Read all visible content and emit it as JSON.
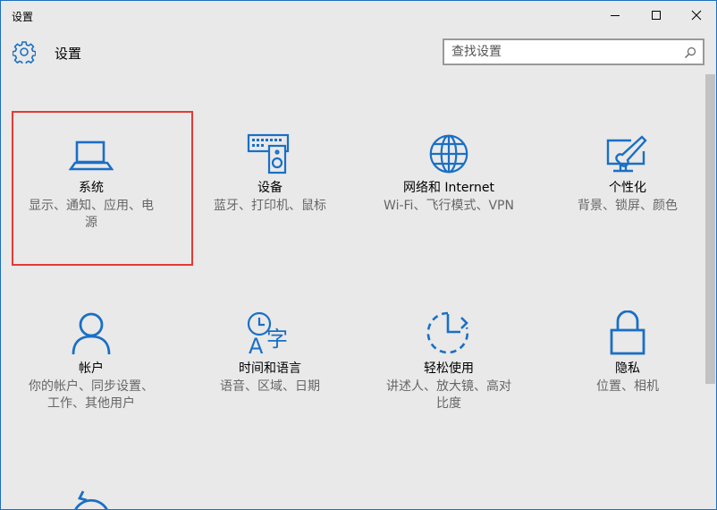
{
  "window": {
    "title": "设置"
  },
  "header": {
    "title": "设置"
  },
  "search": {
    "placeholder": "查找设置"
  },
  "colors": {
    "accent": "#1a6fc5",
    "highlight": "#e53935"
  },
  "tiles": [
    {
      "icon": "laptop-icon",
      "name": "系统",
      "desc1": "显示、通知、应用、电",
      "desc2": "源"
    },
    {
      "icon": "devices-icon",
      "name": "设备",
      "desc1": "蓝牙、打印机、鼠标",
      "desc2": ""
    },
    {
      "icon": "globe-icon",
      "name": "网络和 Internet",
      "desc1": "Wi-Fi、飞行模式、VPN",
      "desc2": ""
    },
    {
      "icon": "personalization-icon",
      "name": "个性化",
      "desc1": "背景、锁屏、颜色",
      "desc2": ""
    },
    {
      "icon": "person-icon",
      "name": "帐户",
      "desc1": "你的帐户、同步设置、",
      "desc2": "工作、其他用户"
    },
    {
      "icon": "time-language-icon",
      "name": "时间和语言",
      "desc1": "语音、区域、日期",
      "desc2": ""
    },
    {
      "icon": "ease-of-access-icon",
      "name": "轻松使用",
      "desc1": "讲述人、放大镜、高对",
      "desc2": "比度"
    },
    {
      "icon": "lock-icon",
      "name": "隐私",
      "desc1": "位置、相机",
      "desc2": ""
    }
  ]
}
